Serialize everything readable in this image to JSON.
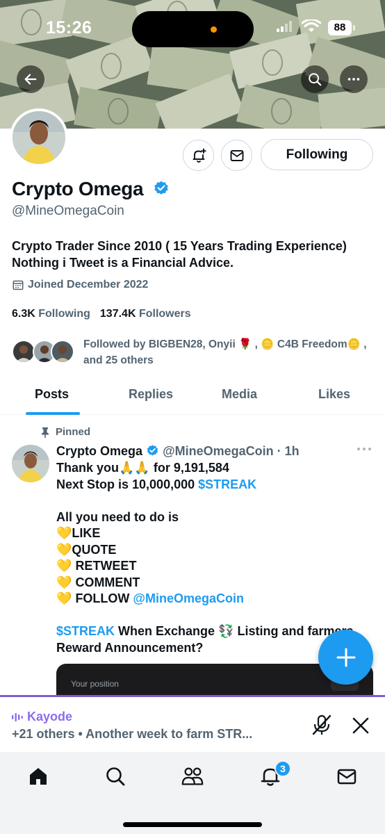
{
  "status_bar": {
    "time": "15:26",
    "battery": "88"
  },
  "profile": {
    "display_name": "Crypto Omega",
    "handle": "@MineOmegaCoin",
    "bio_line1": "Crypto Trader Since 2010 ( 15 Years Trading Experience)",
    "bio_line2": "Nothing i Tweet is a Financial Advice.",
    "joined": "Joined December 2022",
    "following_count": "6.3K",
    "following_label": "Following",
    "followers_count": "137.4K",
    "followers_label": "Followers",
    "following_button": "Following",
    "followed_by_line1": "Followed by BIGBEN28, Onyii 🌹 , 🪙 C4B Freedom🪙 ,",
    "followed_by_line2": "and 25 others"
  },
  "tabs": [
    {
      "label": "Posts"
    },
    {
      "label": "Replies"
    },
    {
      "label": "Media"
    },
    {
      "label": "Likes"
    }
  ],
  "tweet": {
    "pinned_label": "Pinned",
    "author": "Crypto Omega",
    "handle": "@MineOmegaCoin",
    "time": "· 1h",
    "l1a": "Thank you🙏🙏 for 9,191,584",
    "l2a": "Next Stop is 10,000,000 ",
    "l2b": "$STREAK",
    "l4": "All you need to do is",
    "l5": "LIKE",
    "l6": "QUOTE",
    "l7": "RETWEET",
    "l8": "COMMENT",
    "l9a": "FOLLOW ",
    "l9b": "@MineOmegaCoin",
    "l11a": "$STREAK",
    "l11b": " When Exchange 💱 Listing and farmers",
    "l12": "Reward Announcement?",
    "heart": "💛",
    "card_text": "Your position"
  },
  "space": {
    "host": "Kayode",
    "title": "+21 others • Another week to farm STR..."
  },
  "nav": {
    "notifications_badge": "3"
  },
  "colors": {
    "accent": "#1d9bf0",
    "space": "#8b6df0"
  },
  "icons": [
    "back-arrow-icon",
    "search-icon",
    "more-icon",
    "bell-plus-icon",
    "mail-icon",
    "verified-icon",
    "calendar-icon",
    "pin-icon",
    "plus-icon",
    "mic-off-icon",
    "close-icon",
    "home-icon",
    "people-icon",
    "bell-icon"
  ]
}
